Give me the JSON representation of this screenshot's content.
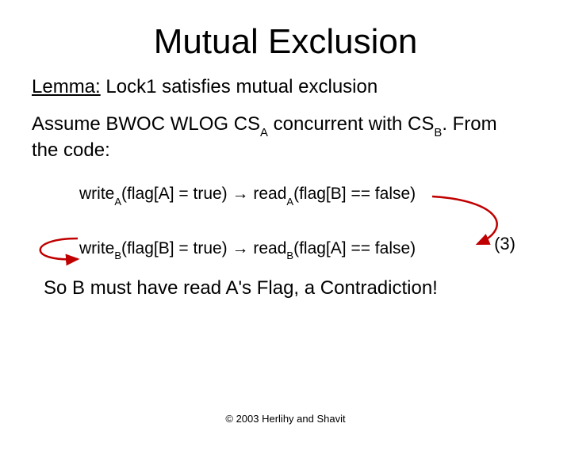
{
  "title": "Mutual Exclusion",
  "lemma": {
    "label": "Lemma:",
    "text": " Lock1 satisfies mutual exclusion"
  },
  "assume": {
    "pre": "Assume BWOC WLOG CS",
    "subA": "A",
    "mid": " concurrent with CS",
    "subB": "B",
    "post": ". From the code:"
  },
  "formula1": {
    "w": "write",
    "wsub": "A",
    "wargs": "(flag[A] = true) ",
    "arrow": "→",
    "r": " read",
    "rsub": "A",
    "rargs": "(flag[B] == false)"
  },
  "formula2": {
    "w": "write",
    "wsub": "B",
    "wargs": "(flag[B] = true) ",
    "arrow": "→",
    "r": " read",
    "rsub": "B",
    "rargs": "(flag[A] == false)"
  },
  "three": "(3)",
  "conclusion": "So B must have read A's Flag, a Contradiction!",
  "credit": "© 2003 Herlihy and Shavit"
}
